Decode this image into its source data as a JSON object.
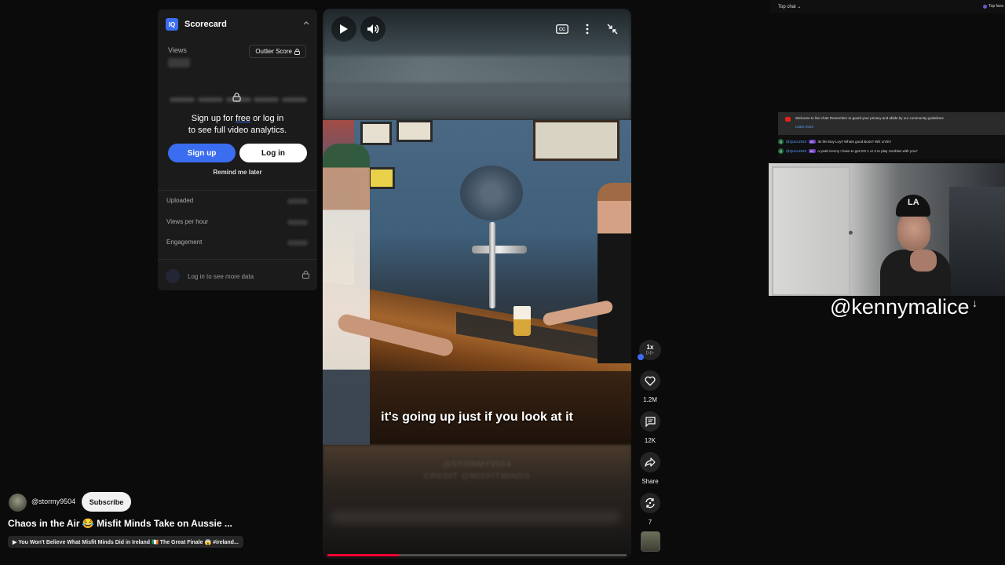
{
  "scorecard": {
    "logo_text": "IQ",
    "title": "Scorecard",
    "views_label": "Views",
    "outlier_label": "Outlier Score",
    "signup_line1_pre": "Sign up for ",
    "signup_free": "free",
    "signup_line1_post": " or log in",
    "signup_line2": "to see full video analytics.",
    "signup_button": "Sign up",
    "login_button": "Log in",
    "remind_label": "Remind me later",
    "stats": [
      "Uploaded",
      "Views per hour",
      "Engagement"
    ],
    "more_data_label": "Log in to see more data"
  },
  "video": {
    "caption": "it's going up just if you look at it",
    "watermark_line1": "@STORMY9504",
    "watermark_line2": "CREDIT @MISFITMINDS",
    "progress": 0.24
  },
  "rail": {
    "speed": "1x",
    "speed_sub": "▷▷",
    "likes": "1.2M",
    "comments": "12K",
    "share": "Share",
    "remix": "7"
  },
  "channel": {
    "handle": "@stormy9504",
    "subscribe_label": "Subscribe",
    "video_title": "Chaos in the Air 😂  Misfit Minds Take on Aussie ...",
    "playlist": "▶ You Won't Believe What Misfit Minds Did in Ireland 🇮🇪 The Great Finale 😱 #ireland..."
  },
  "chat": {
    "top_chat_label": "Top chat",
    "top_fans_label": "Top fans",
    "welcome_text": "Welcome to live chat! Remember to guard your privacy and abide by our community guidelines.",
    "learn_more": "Learn more",
    "messages": [
      {
        "initial": "Q",
        "user": "@Quicc2910",
        "badge": "#1",
        "text": "Its the Boy Loy!! Whats good Boss? WE LIVE!!"
      },
      {
        "initial": "Q",
        "user": "@Quicc2910",
        "badge": "#1",
        "text": "o yeah Kenny I have to get DO 1 or 2 to play zombies with you?"
      }
    ]
  },
  "webcam": {
    "name": "@kennymalice",
    "hat_logo": "LA"
  },
  "colors": {
    "accent_blue": "#3b6df0",
    "progress_red": "#ff0033",
    "background": "#0b0b0b"
  },
  "icons": {
    "play": "play-icon",
    "volume": "volume-icon",
    "captions": "captions-icon",
    "more": "more-vert-icon",
    "exit_fullscreen": "exit-fullscreen-icon",
    "like": "heart-icon",
    "comment": "comment-icon",
    "share": "share-icon",
    "remix": "remix-icon",
    "lock": "lock-icon"
  }
}
